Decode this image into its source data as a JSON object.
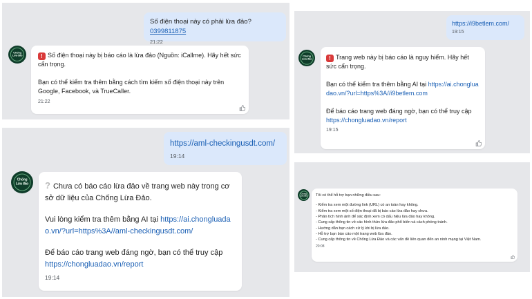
{
  "panel1": {
    "user_msg": {
      "text": "Số điện thoại này có phải lừa đảo? ",
      "phone": "0399811875",
      "time": "21:22"
    },
    "avatar_label": "Chống\nLừa đảo",
    "bot_msg": {
      "line1": "Số điện thoại này bị báo cáo là lừa đảo (Nguồn: iCallme). Hãy hết sức cẩn trọng.",
      "line2": "Bạn có thể kiểm tra thêm bằng cách tìm kiếm số điện thoại này trên Google, Facebook, và TrueCaller.",
      "time": "21:22"
    }
  },
  "panel2": {
    "user_msg": {
      "link": "https://i9betlem.com/",
      "time": "19:15"
    },
    "avatar_label": "Chống\nLừa đảo",
    "bot_msg": {
      "line1": "Trang web này bị báo cáo là nguy hiểm. Hãy hết sức cẩn trọng.",
      "line2_prefix": "Bạn có thể kiểm tra thêm bằng AI tại ",
      "line2_link": "https://ai.chongluadao.vn/?url=https%3A//i9betlem.com",
      "line3_prefix": "Để báo cáo trang web đáng ngờ, bạn có thể truy cập ",
      "line3_link": "https://chongluadao.vn/report",
      "time": "19:15"
    }
  },
  "panel3": {
    "user_msg": {
      "link": "https://aml-checkingusdt.com/",
      "time": "19:14"
    },
    "avatar_label": "Chống\nLừa đảo",
    "bot_msg": {
      "line1": "Chưa có báo cáo lừa đảo về trang web này trong cơ sở dữ liệu của Chống Lừa Đảo.",
      "line2_prefix": "Vui lòng kiểm tra thêm bằng AI tại ",
      "line2_link": "https://ai.chongluadao.vn/?url=https%3A//aml-checkingusdt.com/",
      "line3_prefix": "Để báo cáo trang web đáng ngờ, bạn có thể truy cập ",
      "line3_link": "https://chongluadao.vn/report",
      "time": "19:14"
    }
  },
  "panel4": {
    "avatar_label": "Chống\nLừa đảo",
    "bot_msg": {
      "intro": "Tôi có thể hỗ trợ bạn những điều sau:",
      "items": [
        "- Kiểm tra xem một đường link (URL) có an toàn hay không.",
        "- Kiểm tra xem một số điện thoại đã bị báo cáo lừa đảo hay chưa.",
        "- Phân tích hình ảnh để xác định xem có dấu hiệu lừa đảo hay không.",
        "- Cung cấp thông tin về các hình thức lừa đảo phổ biến và cách phòng tránh.",
        "- Hướng dẫn bạn cách xử lý khi bị lừa đảo.",
        "- Hỗ trợ bạn báo cáo một trang web lừa đảo.",
        "- Cung cấp thông tin về Chống Lừa Đảo và các vấn đề liên quan đến an ninh mạng tại Việt Nam."
      ],
      "time": "20:08"
    }
  },
  "icons": {
    "warning": "warning-icon",
    "question": "question-icon",
    "like": "thumbs-up-icon"
  },
  "colors": {
    "panel_bg": "#e6e7ea",
    "outgoing": "#dbe8fb",
    "incoming": "#ffffff",
    "link": "#1a5fb4",
    "warning": "#d93a3a"
  }
}
